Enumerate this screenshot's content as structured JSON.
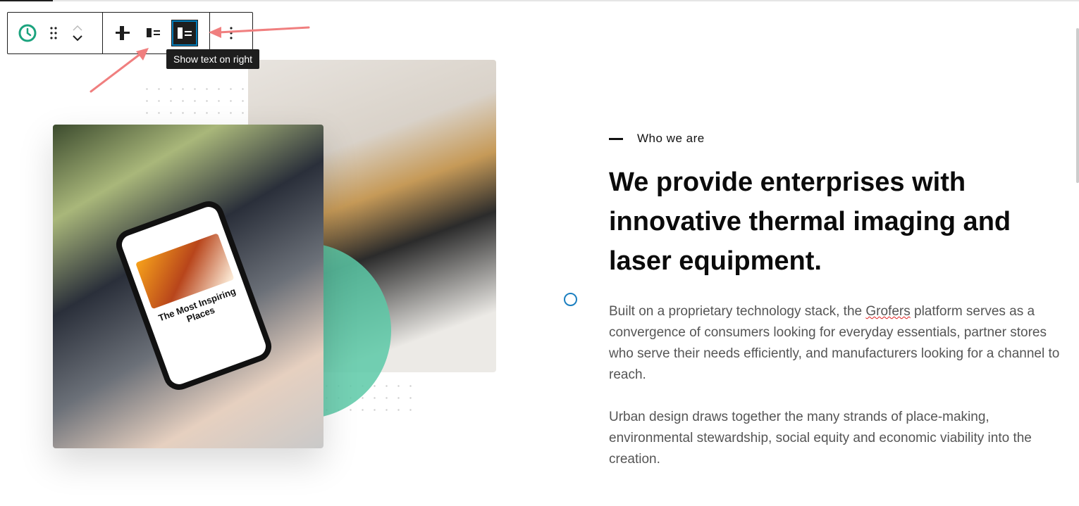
{
  "toolbar": {
    "buttons": [
      {
        "name": "block-type",
        "icon": "clock-icon"
      },
      {
        "name": "drag",
        "icon": "drag-handle-icon"
      },
      {
        "name": "move-up",
        "icon": "chevron-up-icon"
      },
      {
        "name": "move-down",
        "icon": "chevron-down-icon"
      },
      {
        "name": "align",
        "icon": "vertical-align-icon"
      },
      {
        "name": "show-media-on-left",
        "icon": "media-left-icon"
      },
      {
        "name": "show-text-on-right",
        "icon": "media-left-active-icon",
        "active": true
      },
      {
        "name": "options",
        "icon": "more-vertical-icon"
      }
    ],
    "tooltip": "Show text on right",
    "accent": "#007cba",
    "icon_green": "#1ba37e"
  },
  "annotation_color": "#f07f7f",
  "media": {
    "phone_text": "The Most Inspiring Places",
    "circle_color": "#5cc9a7"
  },
  "content": {
    "eyebrow": "Who we are",
    "headline": "We provide enterprises with innovative thermal imaging and laser equipment.",
    "p1_before": "Built on a proprietary technology stack, the ",
    "p1_brand": "Grofers",
    "p1_after": " platform serves as a convergence of consumers looking for everyday essentials, partner stores who serve their needs efficiently, and manufacturers looking for a channel to reach.",
    "p2": "Urban design draws together the many strands of place-making, environmental stewardship, social equity and economic viability into the creation."
  }
}
